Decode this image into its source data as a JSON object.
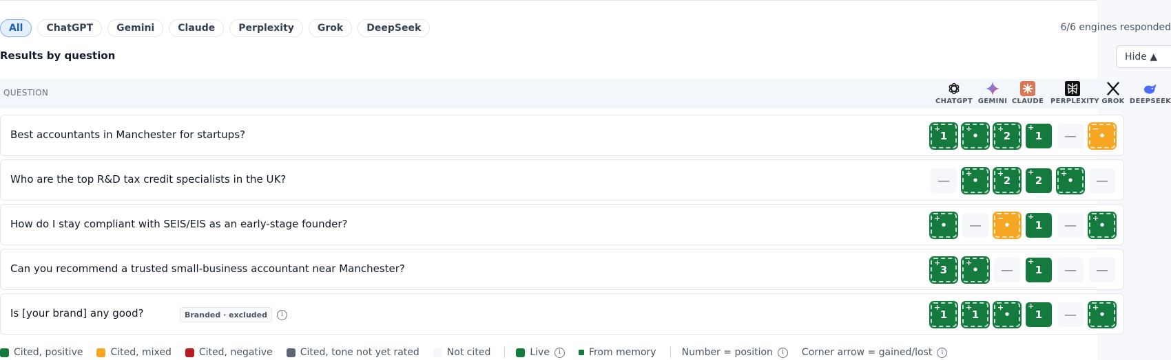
{
  "filters": [
    {
      "label": "All",
      "active": true
    },
    {
      "label": "ChatGPT"
    },
    {
      "label": "Gemini"
    },
    {
      "label": "Claude"
    },
    {
      "label": "Perplexity"
    },
    {
      "label": "Grok"
    },
    {
      "label": "DeepSeek"
    }
  ],
  "engines_responded": "6/6 engines responded",
  "section_title": "Results by question",
  "hide_label": "Hide ▲",
  "table": {
    "question_header": "QUESTION",
    "engines": [
      {
        "name": "CHATGPT",
        "icon": "chatgpt-logo-icon"
      },
      {
        "name": "GEMINI",
        "icon": "gemini-logo-icon"
      },
      {
        "name": "CLAUDE",
        "icon": "claude-logo-icon"
      },
      {
        "name": "PERPLEXITY",
        "icon": "perplexity-logo-icon"
      },
      {
        "name": "GROK",
        "icon": "grok-logo-icon"
      },
      {
        "name": "DEEPSEEK",
        "icon": "deepseek-logo-icon"
      }
    ],
    "rows": [
      {
        "question": "Best accountants in Manchester for startups?",
        "cells": [
          {
            "v": "1",
            "tone": "positive",
            "mem": true,
            "arrow": "+"
          },
          {
            "v": "•",
            "tone": "positive",
            "mem": true,
            "arrow": "+"
          },
          {
            "v": "2",
            "tone": "positive",
            "mem": true,
            "arrow": "+"
          },
          {
            "v": "1",
            "tone": "positive",
            "mem": false,
            "arrow": "+"
          },
          {
            "v": "—",
            "tone": "none"
          },
          {
            "v": "•",
            "tone": "mixed",
            "mem": true,
            "arrow": "−"
          }
        ]
      },
      {
        "question": "Who are the top R&D tax credit specialists in the UK?",
        "cells": [
          {
            "v": "—",
            "tone": "none"
          },
          {
            "v": "•",
            "tone": "positive",
            "mem": true,
            "arrow": "+"
          },
          {
            "v": "2",
            "tone": "positive",
            "mem": true,
            "arrow": "+"
          },
          {
            "v": "2",
            "tone": "positive",
            "mem": false,
            "arrow": "+"
          },
          {
            "v": "•",
            "tone": "positive",
            "mem": true,
            "arrow": "+"
          },
          {
            "v": "—",
            "tone": "none"
          }
        ]
      },
      {
        "question": "How do I stay compliant with SEIS/EIS as an early-stage founder?",
        "cells": [
          {
            "v": "•",
            "tone": "positive",
            "mem": true,
            "arrow": "+"
          },
          {
            "v": "—",
            "tone": "none"
          },
          {
            "v": "•",
            "tone": "mixed",
            "mem": true,
            "arrow": "−"
          },
          {
            "v": "1",
            "tone": "positive",
            "mem": false,
            "arrow": "+"
          },
          {
            "v": "—",
            "tone": "none"
          },
          {
            "v": "•",
            "tone": "positive",
            "mem": true,
            "arrow": "+"
          }
        ]
      },
      {
        "question": "Can you recommend a trusted small-business accountant near Manchester?",
        "cells": [
          {
            "v": "3",
            "tone": "positive",
            "mem": true,
            "arrow": "+"
          },
          {
            "v": "•",
            "tone": "positive",
            "mem": true,
            "arrow": "+"
          },
          {
            "v": "—",
            "tone": "none"
          },
          {
            "v": "1",
            "tone": "positive",
            "mem": false,
            "arrow": "+"
          },
          {
            "v": "—",
            "tone": "none"
          },
          {
            "v": "—",
            "tone": "none"
          }
        ]
      },
      {
        "question": "Is [your brand] any good?",
        "badge": "Branded · excluded",
        "cells": [
          {
            "v": "1",
            "tone": "positive",
            "mem": true,
            "arrow": "+"
          },
          {
            "v": "1",
            "tone": "positive",
            "mem": true,
            "arrow": "+"
          },
          {
            "v": "•",
            "tone": "positive",
            "mem": true,
            "arrow": "+"
          },
          {
            "v": "1",
            "tone": "positive",
            "mem": false,
            "arrow": "+"
          },
          {
            "v": "—",
            "tone": "none"
          },
          {
            "v": "•",
            "tone": "positive",
            "mem": true,
            "arrow": "+"
          }
        ]
      }
    ]
  },
  "legend": {
    "cited_positive": "Cited, positive",
    "cited_mixed": "Cited, mixed",
    "cited_negative": "Cited, negative",
    "cited_unrated": "Cited, tone not yet rated",
    "not_cited": "Not cited",
    "live": "Live",
    "from_memory": "From memory",
    "number_position": "Number = position",
    "corner_arrow": "Corner arrow = gained/lost"
  },
  "colors": {
    "positive": "#157a3d",
    "mixed": "#f5a623",
    "negative": "#b91c1c",
    "unrated": "#5f6673",
    "none": "#f5f7fa"
  }
}
